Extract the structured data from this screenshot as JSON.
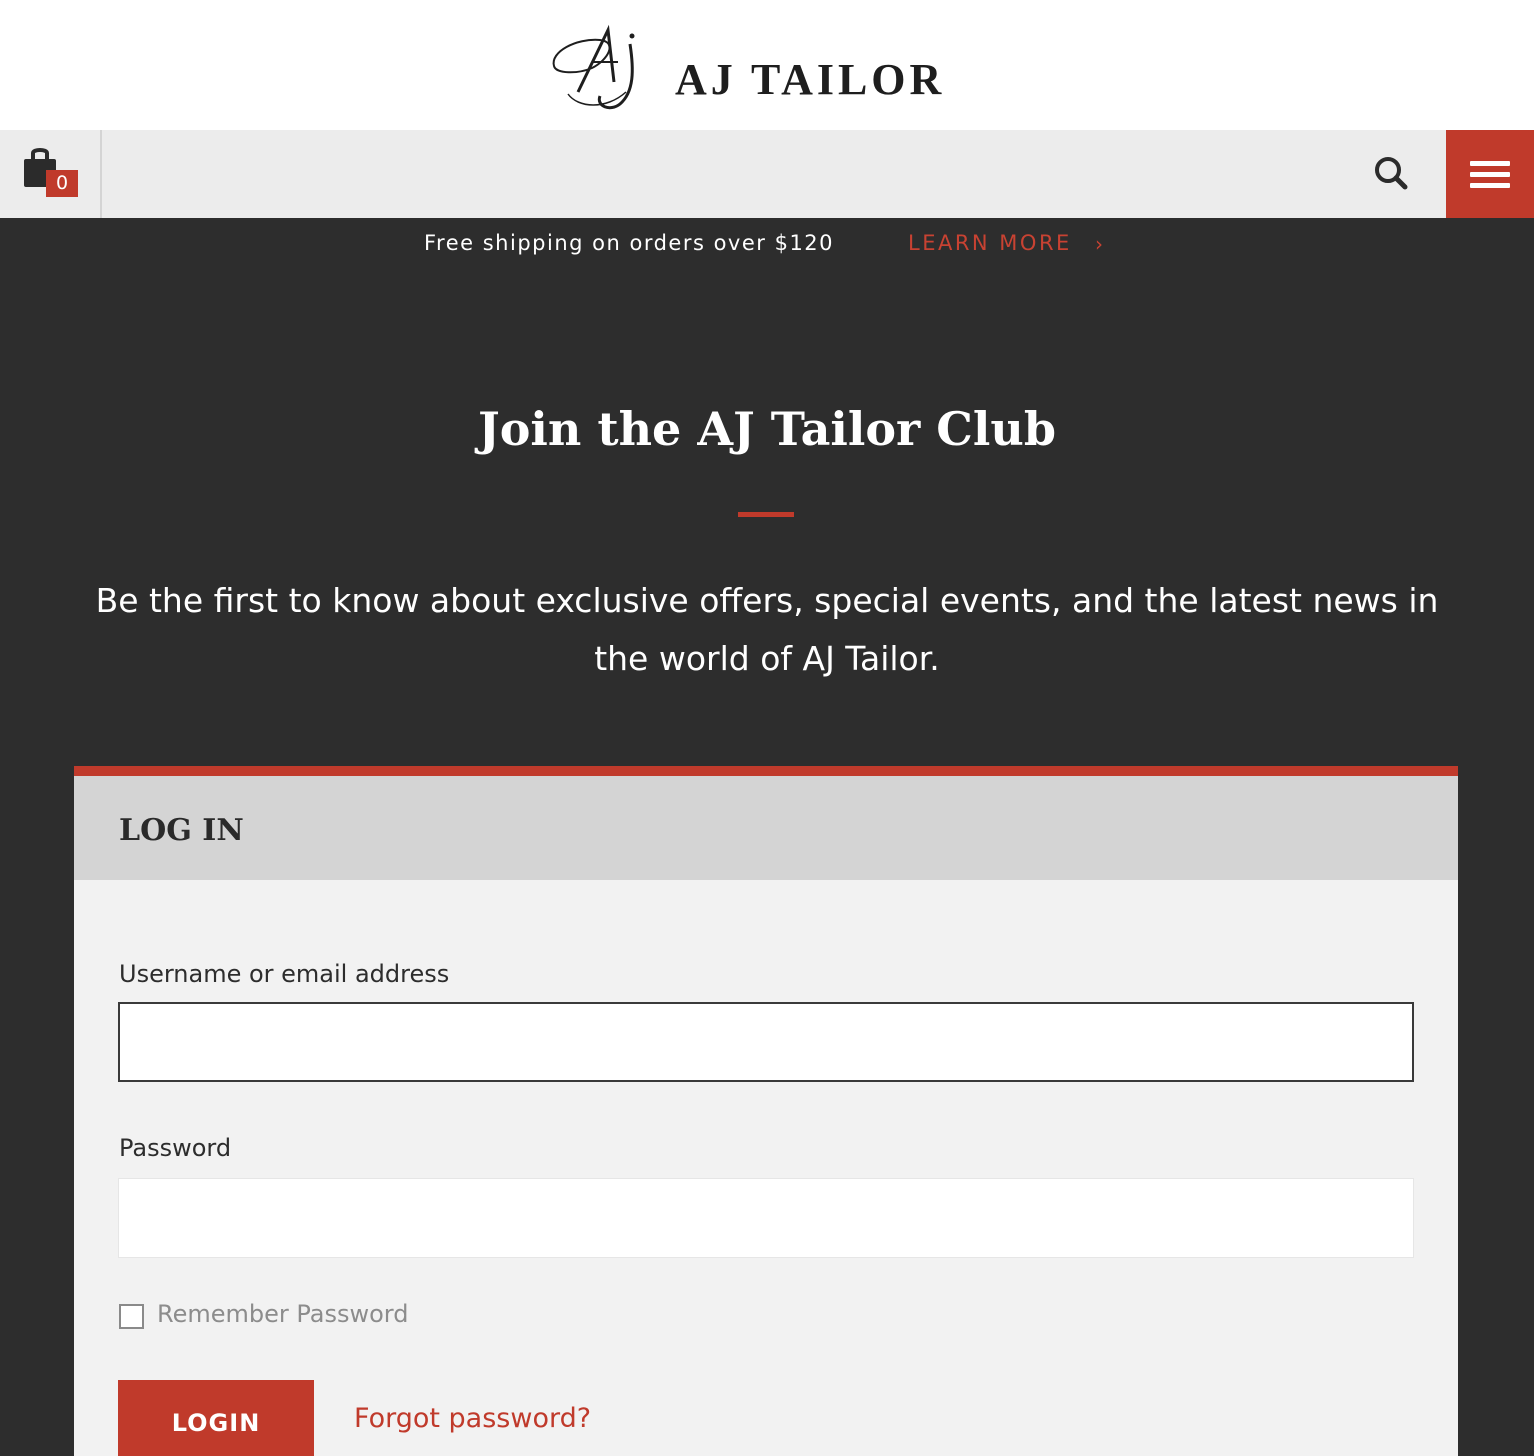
{
  "brand": {
    "name": "AJ TAILOR",
    "monogram": "AJ",
    "accent_color": "#c03a2b"
  },
  "toolbar": {
    "cart_icon": "shopping-bag-icon",
    "cart_count": "0",
    "search_icon": "search-icon",
    "menu_icon": "hamburger-menu-icon"
  },
  "promo": {
    "text": "Free shipping on orders over $120",
    "link_label": "LEARN MORE",
    "chevron": "›"
  },
  "hero": {
    "title": "Join the AJ Tailor Club",
    "subtitle": "Be the first to know about exclusive offers, special events, and the latest news in the world of AJ Tailor."
  },
  "login": {
    "heading": "LOG IN",
    "username_label": "Username or email address",
    "username_value": "",
    "password_label": "Password",
    "password_value": "",
    "remember_label": "Remember Password",
    "remember_checked": false,
    "submit_label": "LOGIN",
    "forgot_label": "Forgot password?"
  }
}
